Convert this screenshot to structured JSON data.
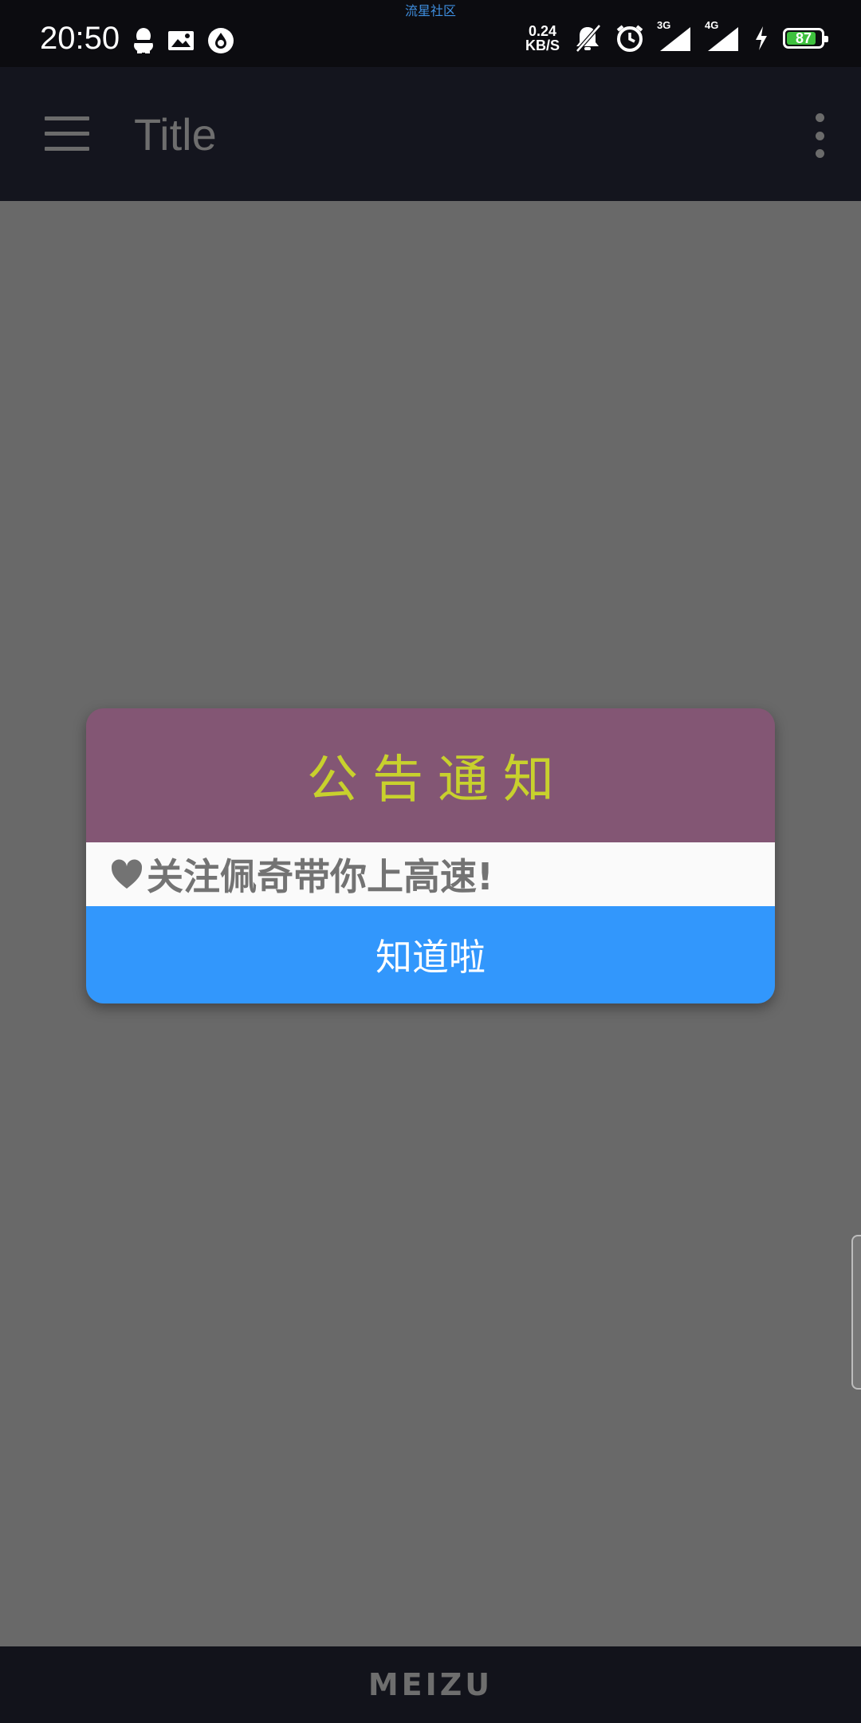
{
  "status_bar": {
    "top_label": "流星社区",
    "time": "20:50",
    "net_speed_value": "0.24",
    "net_speed_unit": "KB/S",
    "signal_1_label": "3G",
    "signal_2_label": "4G",
    "battery_level": "87",
    "battery_fraction": 0.87,
    "battery_color": "#3ec13e",
    "left_icons": [
      "qq-icon",
      "image-message-icon",
      "drop-app-icon"
    ],
    "right_icons": [
      "mute-bell-icon",
      "alarm-icon",
      "signal-3g-icon",
      "signal-4g-icon",
      "charging-icon",
      "battery-icon"
    ]
  },
  "app_bar": {
    "title": "Title",
    "menu_icon": "hamburger-menu-icon",
    "overflow_icon": "more-vertical-icon"
  },
  "dialog": {
    "title": "公告通知",
    "message": "关注佩奇带你上高速!",
    "message_icon": "heart-icon",
    "button_label": "知道啦",
    "colors": {
      "header": "#835674",
      "title": "#c8d12d",
      "button": "#3297fc"
    }
  },
  "nav_bar": {
    "brand": "MEIZU"
  }
}
